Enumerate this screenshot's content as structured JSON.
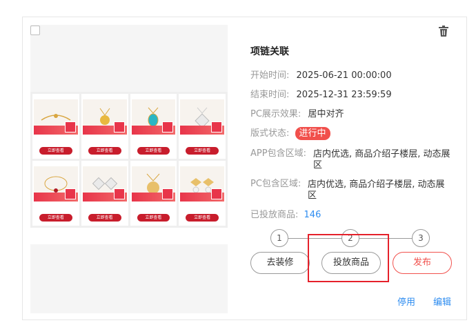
{
  "card": {
    "title": "项链关联",
    "start_label": "开始时间:",
    "start_value": "2025-06-21 00:00:00",
    "end_label": "结束时间:",
    "end_value": "2025-12-31 23:59:59",
    "pc_effect_label": "PC展示效果:",
    "pc_effect_value": "居中对齐",
    "status_label": "版式状态:",
    "status_value": "进行中",
    "app_area_label": "APP包含区域:",
    "app_area_value_line1": "店内优选, 商品介绍子楼层, 动态展",
    "app_area_value_line2": "区",
    "pc_area_label": "PC包含区域:",
    "pc_area_value_line1": "店内优选, 商品介绍子楼层, 动态展",
    "pc_area_value_line2": "区",
    "placed_label": "已投放商品:",
    "placed_value": "146"
  },
  "steps": [
    "1",
    "2",
    "3"
  ],
  "buttons": {
    "decorate": "去装修",
    "place": "投放商品",
    "publish": "发布"
  },
  "footer": {
    "disable": "停用",
    "edit": "编辑"
  },
  "preview_tiles": [
    {
      "button": "立即查看"
    },
    {
      "button": "立即查看"
    },
    {
      "button": "立即查看"
    },
    {
      "button": "立即查看"
    },
    {
      "button": "立即查看"
    },
    {
      "button": "立即查看"
    },
    {
      "button": "立即查看"
    },
    {
      "button": "立即查看"
    }
  ],
  "colors": {
    "accent_red": "#f1504c",
    "link_blue": "#2d8cf0",
    "highlight_red": "#e5202a"
  },
  "icons": [
    "checkbox-icon",
    "trash-icon"
  ]
}
